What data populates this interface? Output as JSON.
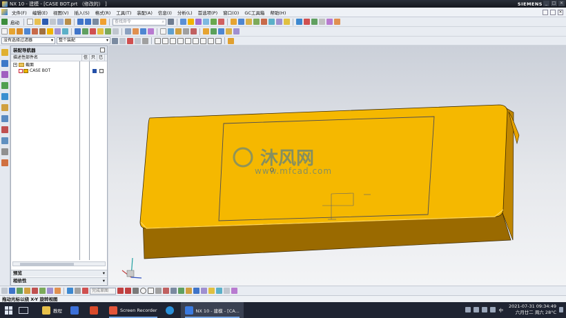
{
  "window": {
    "title": "NX 10 - 建模 - [CASE BOT.prt （修改的） ]",
    "brand": "SIEMENS"
  },
  "menu": {
    "items": [
      "文件(F)",
      "编辑(E)",
      "视图(V)",
      "插入(S)",
      "格式(R)",
      "工具(T)",
      "装配(A)",
      "信息(I)",
      "分析(L)",
      "首选项(P)",
      "窗口(O)",
      "GC工具箱",
      "帮助(H)"
    ]
  },
  "toolbar": {
    "start_label": "启动",
    "search_placeholder": "查找命令",
    "filter_value": "没有选择过滤器",
    "assembly_scope": "整个装配"
  },
  "navigator": {
    "title": "装配导航器",
    "columns": [
      "描述性部件名",
      "信",
      "只",
      "已"
    ],
    "rows": [
      {
        "label": "截面",
        "type": "folder"
      },
      {
        "label": "CASE BOT",
        "type": "part"
      }
    ],
    "panels": [
      "预览",
      "相依性"
    ]
  },
  "viewport": {
    "background_top": "#cbd0d9",
    "background_bottom": "#f3f4f6",
    "part_color": "#f5b800",
    "watermark_brand": "沐风网",
    "watermark_url": "www.mfcad.com"
  },
  "bottom_toolbar": {
    "dropdown_label": "完成草图"
  },
  "status": {
    "text": "拖动光标以绕 X-Y 旋转视图"
  },
  "taskbar": {
    "apps": [
      {
        "label": "教程",
        "color": "#e7c04a"
      },
      {
        "label": "",
        "color": "#3b6fd8"
      },
      {
        "label": "",
        "color": "#d84a2a"
      },
      {
        "label": "Screen Recorder",
        "color": "#e2553a"
      },
      {
        "label": "",
        "color": "#2a8fd8"
      },
      {
        "label": "NX 10 - 建模 - [CA...",
        "color": "#3b7be0"
      }
    ],
    "clock_time": "2021-07-31 09:34:49",
    "clock_date": "六月廿二 周六 28°C",
    "lang": "中"
  }
}
